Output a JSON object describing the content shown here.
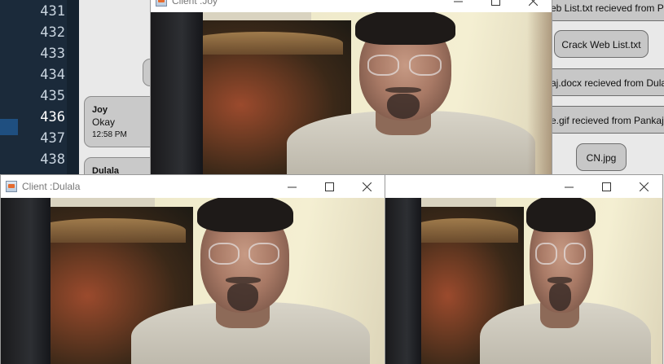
{
  "editor": {
    "line_numbers": [
      "431",
      "432",
      "433",
      "434",
      "435",
      "436",
      "437",
      "438"
    ]
  },
  "chat": {
    "message": {
      "sender": "Joy",
      "text": "Okay",
      "time": "12:58 PM"
    },
    "next_sender": "Dulala",
    "files": {
      "web_list_received": "eb List.txt recieved from P",
      "crack_web_list": "Crack Web List.txt",
      "docx_received": "aj.docx recieved from Dula",
      "gif_received": "e.gif recieved from Pankaj",
      "cn_jpg": "CN.jpg"
    }
  },
  "windows": {
    "joy": {
      "title": "Client :Joy"
    },
    "dulala": {
      "title": "Client :Dulala"
    },
    "third": {
      "title": ""
    }
  },
  "icons": {
    "app": "java-window-icon",
    "minimize": "minimize-icon",
    "maximize": "maximize-icon",
    "close": "close-icon"
  }
}
